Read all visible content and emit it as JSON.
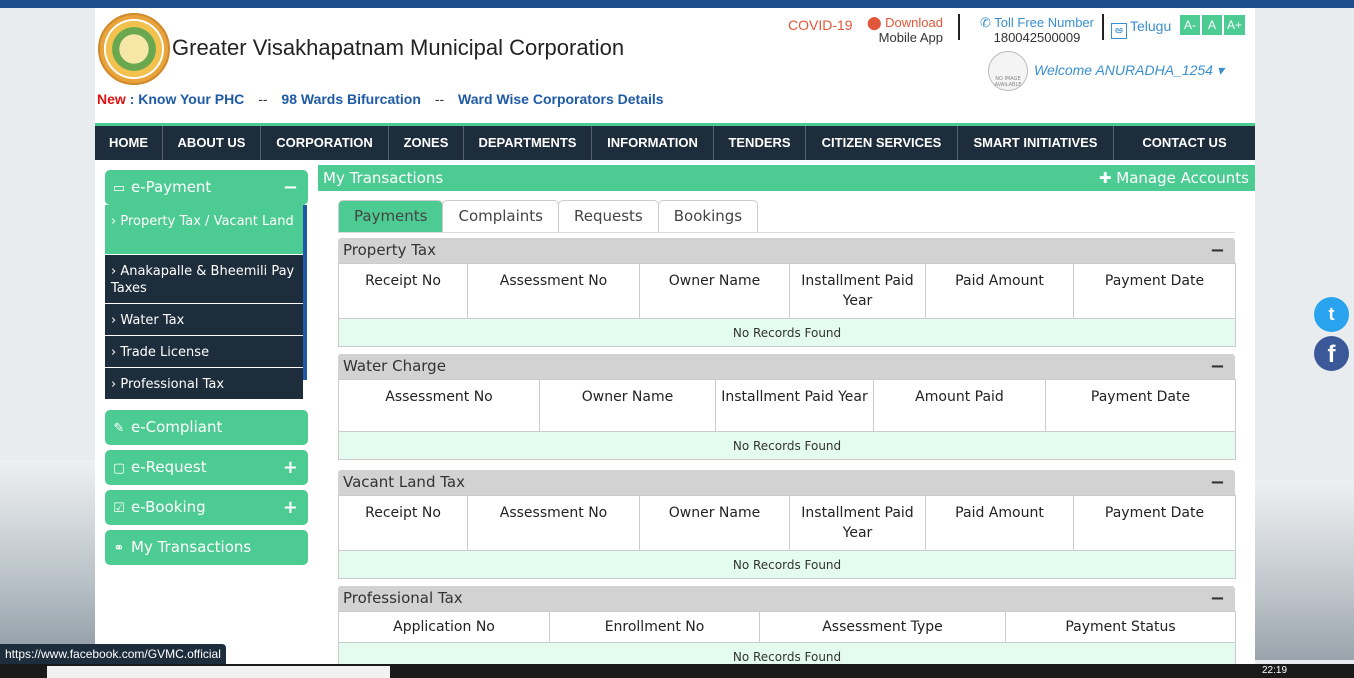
{
  "header": {
    "org_name": "Greater Visakhapatnam Municipal Corporation",
    "new_label": "New",
    "links": [
      "Know Your PHC",
      "98 Wards Bifurcation",
      "Ward Wise Corporators Details"
    ],
    "link_sep": "--",
    "covid": "COVID-19",
    "download_line1": "Download",
    "download_line2": "Mobile App",
    "tollfree_label": "Toll Free Number",
    "tollfree_number": "180042500009",
    "language": "Telugu",
    "font_buttons": [
      "A-",
      "A",
      "A+"
    ],
    "profile_placeholder": "NO IMAGE AVAILABLE",
    "welcome": "Welcome ANURADHA_1254 ▾"
  },
  "nav": [
    "HOME",
    "ABOUT US",
    "CORPORATION",
    "ZONES",
    "DEPARTMENTS",
    "INFORMATION",
    "TENDERS",
    "CITIZEN SERVICES",
    "SMART INITIATIVES",
    "CONTACT US"
  ],
  "sidebar": {
    "epayment": {
      "label": "e-Payment",
      "toggle": "−"
    },
    "epayment_items": [
      "› Property Tax / Vacant Land",
      "› Anakapalle & Bheemili Pay Taxes",
      "› Water Tax",
      "› Trade License",
      "› Professional Tax"
    ],
    "ecompliant": {
      "label": "e-Compliant"
    },
    "erequest": {
      "label": "e-Request",
      "toggle": "+"
    },
    "ebooking": {
      "label": "e-Booking",
      "toggle": "+"
    },
    "mytransactions": {
      "label": "My Transactions"
    }
  },
  "main": {
    "title": "My Transactions",
    "manage": "✚ Manage Accounts",
    "tabs": [
      "Payments",
      "Complaints",
      "Requests",
      "Bookings"
    ],
    "panels": [
      {
        "title": "Property Tax",
        "cols": [
          "Receipt No",
          "Assessment No",
          "Owner Name",
          "Installment Paid Year",
          "Paid Amount",
          "Payment Date"
        ],
        "empty": "No Records Found"
      },
      {
        "title": "Water Charge",
        "cols": [
          "Assessment No",
          "Owner Name",
          "Installment Paid Year",
          "Amount Paid",
          "Payment Date"
        ],
        "empty": "No Records Found"
      },
      {
        "title": "Vacant Land Tax",
        "cols": [
          "Receipt No",
          "Assessment No",
          "Owner Name",
          "Installment Paid Year",
          "Paid Amount",
          "Payment Date"
        ],
        "empty": "No Records Found"
      },
      {
        "title": "Professional Tax",
        "cols": [
          "Application No",
          "Enrollment No",
          "Assessment Type",
          "Payment Status"
        ],
        "empty": "No Records Found"
      }
    ],
    "minimize": "−"
  },
  "status_url": "https://www.facebook.com/GVMC.official",
  "clock": "22:19",
  "colors": {
    "accent": "#4ccc92",
    "nav_bg": "#1e2d3b",
    "link": "#1e5aa5"
  }
}
